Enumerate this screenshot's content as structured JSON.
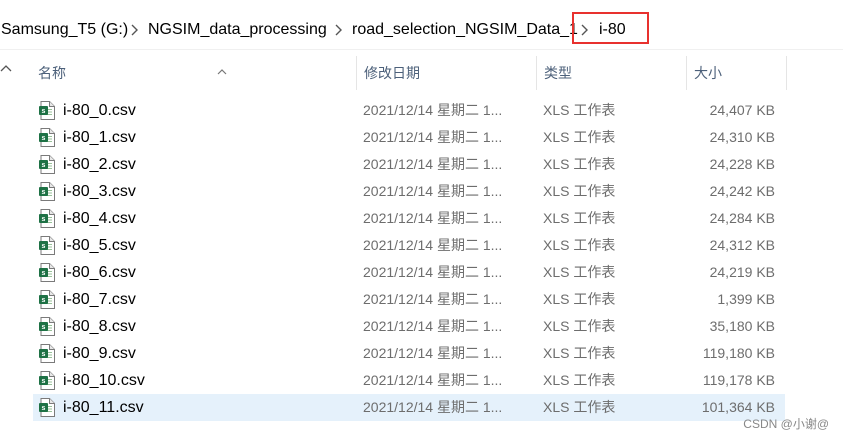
{
  "breadcrumb": {
    "items": [
      "Samsung_T5 (G:)",
      "NGSIM_data_processing",
      "road_selection_NGSIM_Data_1",
      "i-80"
    ]
  },
  "columns": {
    "name": "名称",
    "date": "修改日期",
    "type": "类型",
    "size": "大小"
  },
  "files": [
    {
      "name": "i-80_0.csv",
      "date": "2021/12/14 星期二 1...",
      "type": "XLS 工作表",
      "size": "24,407 KB"
    },
    {
      "name": "i-80_1.csv",
      "date": "2021/12/14 星期二 1...",
      "type": "XLS 工作表",
      "size": "24,310 KB"
    },
    {
      "name": "i-80_2.csv",
      "date": "2021/12/14 星期二 1...",
      "type": "XLS 工作表",
      "size": "24,228 KB"
    },
    {
      "name": "i-80_3.csv",
      "date": "2021/12/14 星期二 1...",
      "type": "XLS 工作表",
      "size": "24,242 KB"
    },
    {
      "name": "i-80_4.csv",
      "date": "2021/12/14 星期二 1...",
      "type": "XLS 工作表",
      "size": "24,284 KB"
    },
    {
      "name": "i-80_5.csv",
      "date": "2021/12/14 星期二 1...",
      "type": "XLS 工作表",
      "size": "24,312 KB"
    },
    {
      "name": "i-80_6.csv",
      "date": "2021/12/14 星期二 1...",
      "type": "XLS 工作表",
      "size": "24,219 KB"
    },
    {
      "name": "i-80_7.csv",
      "date": "2021/12/14 星期二 1...",
      "type": "XLS 工作表",
      "size": "1,399 KB"
    },
    {
      "name": "i-80_8.csv",
      "date": "2021/12/14 星期二 1...",
      "type": "XLS 工作表",
      "size": "35,180 KB"
    },
    {
      "name": "i-80_9.csv",
      "date": "2021/12/14 星期二 1...",
      "type": "XLS 工作表",
      "size": "119,180 KB"
    },
    {
      "name": "i-80_10.csv",
      "date": "2021/12/14 星期二 1...",
      "type": "XLS 工作表",
      "size": "119,178 KB"
    },
    {
      "name": "i-80_11.csv",
      "date": "2021/12/14 星期二 1...",
      "type": "XLS 工作表",
      "size": "101,364 KB",
      "selected": true
    }
  ],
  "file_icon": "excel-csv-icon",
  "selection_color": "#e5f1fb",
  "highlight_color": "#e8312e",
  "watermark": "CSDN @小谢@"
}
